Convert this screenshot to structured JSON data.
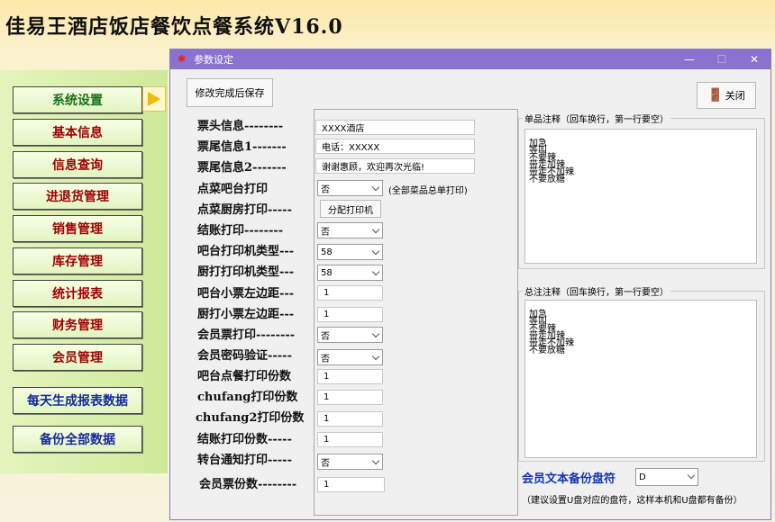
{
  "app": {
    "title": "佳易王酒店饭店餐饮点餐系统V16.0"
  },
  "sidebar": {
    "items": [
      {
        "label": "系统设置"
      },
      {
        "label": "基本信息"
      },
      {
        "label": "信息查询"
      },
      {
        "label": "进退货管理"
      },
      {
        "label": "销售管理"
      },
      {
        "label": "库存管理"
      },
      {
        "label": "统计报表"
      },
      {
        "label": "财务管理"
      },
      {
        "label": "会员管理"
      },
      {
        "label": "每天生成报表数据"
      },
      {
        "label": "备份全部数据"
      }
    ]
  },
  "dialog": {
    "title": "参数设定",
    "save_label": "修改完成后保存",
    "close_label": "关闭",
    "rows": [
      {
        "label": "票头信息--------",
        "value": "XXXX酒店"
      },
      {
        "label": "票尾信息1-------",
        "value": "电话：XXXXX"
      },
      {
        "label": "票尾信息2-------",
        "value": "谢谢惠顾，欢迎再次光临!"
      },
      {
        "label": "点菜吧台打印",
        "value": "否",
        "note": "(全部菜品总单打印)"
      },
      {
        "label": "点菜厨房打印-----",
        "button": "分配打印机"
      },
      {
        "label": "结账打印--------",
        "value": "否"
      },
      {
        "label": "吧台打印机类型---",
        "value": "58"
      },
      {
        "label": "厨打打印机类型---",
        "value": "58"
      },
      {
        "label": "吧台小票左边距---",
        "value": "1"
      },
      {
        "label": "厨打小票左边距---",
        "value": "1"
      },
      {
        "label": "会员票打印--------",
        "value": "否"
      },
      {
        "label": "会员密码验证-----",
        "value": "否"
      },
      {
        "label": "吧台点餐打印份数",
        "value": "1"
      },
      {
        "label": "chufang打印份数",
        "value": "1"
      },
      {
        "label": "chufang2打印份数",
        "value": "1"
      },
      {
        "label": "结账打印份数-----",
        "value": "1"
      },
      {
        "label": "转台通知打印-----",
        "value": "否"
      },
      {
        "label": "会员票份数--------",
        "value": "1"
      }
    ],
    "single_note": {
      "title": "单品注释（回车换行，第一行要空）",
      "lines": [
        "加急",
        "等叫",
        "不要辣",
        "带走加辣",
        "带走不加辣",
        "不要放糖"
      ]
    },
    "total_note": {
      "title": "总注注释（回车换行，第一行要空）",
      "lines": [
        "加急",
        "等叫",
        "不要辣",
        "带走加辣",
        "带走不加辣",
        "不要放糖"
      ]
    },
    "backup": {
      "label": "会员文本备份盘符",
      "value": "D",
      "hint": "（建议设置U盘对应的盘符，这样本机和U盘都有备份）"
    }
  }
}
